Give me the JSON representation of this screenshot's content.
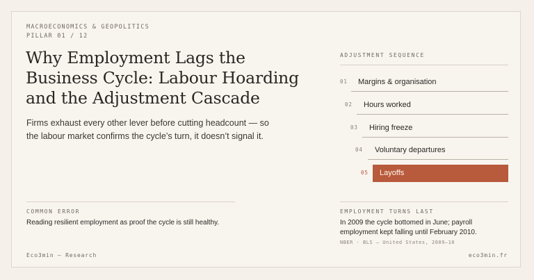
{
  "header": {
    "kicker": "MACROECONOMICS & GEOPOLITICS",
    "pillar": "PILLAR 01 / 12",
    "title": "Why Employment Lags the Business Cycle: Labour Hoarding and the Adjustment Cascade",
    "subtitle": "Firms exhaust every other lever before cutting headcount — so the labour market confirms the cycle’s turn, it doesn’t signal it."
  },
  "sequence": {
    "label": "ADJUSTMENT SEQUENCE",
    "steps": [
      {
        "num": "01",
        "label": "Margins & organisation"
      },
      {
        "num": "02",
        "label": "Hours worked"
      },
      {
        "num": "03",
        "label": "Hiring freeze"
      },
      {
        "num": "04",
        "label": "Voluntary departures"
      },
      {
        "num": "05",
        "label": "Layoffs"
      }
    ],
    "active_index": 4
  },
  "common_error": {
    "label": "COMMON ERROR",
    "text": "Reading resilient employment as proof the cycle is still healthy."
  },
  "employment_turns": {
    "label": "EMPLOYMENT TURNS LAST",
    "text": "In 2009 the cycle bottomed in June; payroll employment kept falling until February 2010.",
    "source": "NBER · BLS — United States, 2009–10"
  },
  "footer": {
    "left": "Eco3min — Research",
    "right": "eco3min.fr"
  },
  "colors": {
    "accent": "#b85a3c",
    "background": "#f8f5ef"
  }
}
